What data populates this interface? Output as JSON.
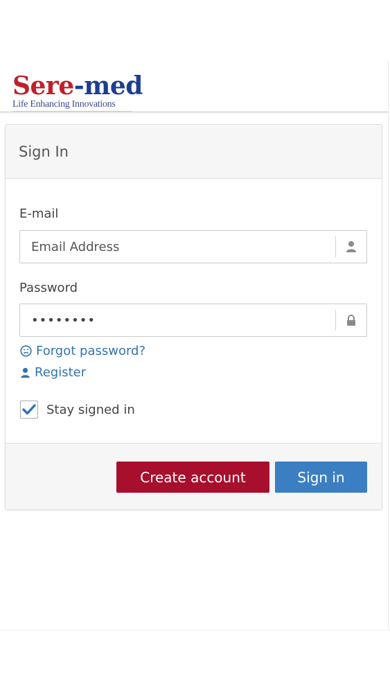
{
  "brand": {
    "name_part1": "Sere",
    "name_part2": "-med",
    "tagline": "Life Enhancing Innovations",
    "colors": {
      "red": "#c0202a",
      "blue": "#1d3e8f"
    }
  },
  "panel": {
    "title": "Sign In"
  },
  "form": {
    "email_label": "E-mail",
    "email_placeholder": "Email Address",
    "email_icon": "user-icon",
    "password_label": "Password",
    "password_value": "••••••••",
    "password_icon": "lock-icon",
    "forgot_link": "Forgot password?",
    "forgot_icon": "frown-icon",
    "register_link": "Register",
    "register_icon": "user-icon",
    "stay_signed_in_label": "Stay signed in",
    "stay_signed_in_checked": true
  },
  "actions": {
    "create_account_label": "Create account",
    "sign_in_label": "Sign in",
    "colors": {
      "create": "#a80f2d",
      "sign_in": "#3b7fc2"
    }
  }
}
